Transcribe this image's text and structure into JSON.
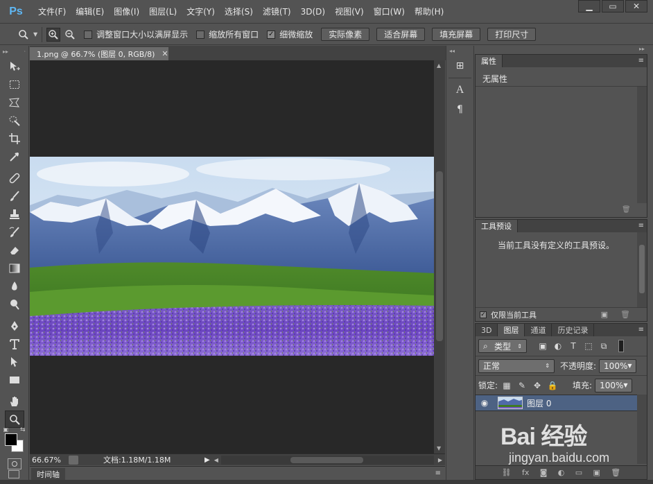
{
  "app": {
    "logo": "Ps",
    "menu": [
      "文件(F)",
      "编辑(E)",
      "图像(I)",
      "图层(L)",
      "文字(Y)",
      "选择(S)",
      "滤镜(T)",
      "3D(D)",
      "视图(V)",
      "窗口(W)",
      "帮助(H)"
    ]
  },
  "options": {
    "checkbox_resize": "调整窗口大小以满屏显示",
    "checkbox_zoom_all": "缩放所有窗口",
    "checkbox_scrubby": "细微缩放",
    "scrubby_checked": "✓",
    "btn_actual": "实际像素",
    "btn_fit": "适合屏幕",
    "btn_fill": "填充屏幕",
    "btn_print": "打印尺寸"
  },
  "document": {
    "tab_title": "1.png @ 66.7% (图层 0, RGB/8)",
    "zoom": "66.67%",
    "doc_info": "文档:1.18M/1.18M",
    "timeline_tab": "时间轴"
  },
  "panels": {
    "properties_tab": "属性",
    "properties_empty": "无属性",
    "presets_tab": "工具预设",
    "presets_empty": "当前工具没有定义的工具预设。",
    "presets_checkbox": "仅限当前工具",
    "layers_tabs": [
      "3D",
      "图层",
      "通道",
      "历史记录"
    ],
    "filter_kind": "类型",
    "blend_mode": "正常",
    "opacity_label": "不透明度:",
    "opacity_value": "100%",
    "lock_label": "锁定:",
    "fill_label": "填充:",
    "fill_value": "100%",
    "layer_name": "图层 0"
  },
  "colors": {
    "ps_blue": "#5fb8f5",
    "layer_selected": "#4d6283",
    "canvas_bg": "#282828"
  },
  "watermark": {
    "logo": "Bai 经验",
    "url": "jingyan.baidu.com"
  }
}
